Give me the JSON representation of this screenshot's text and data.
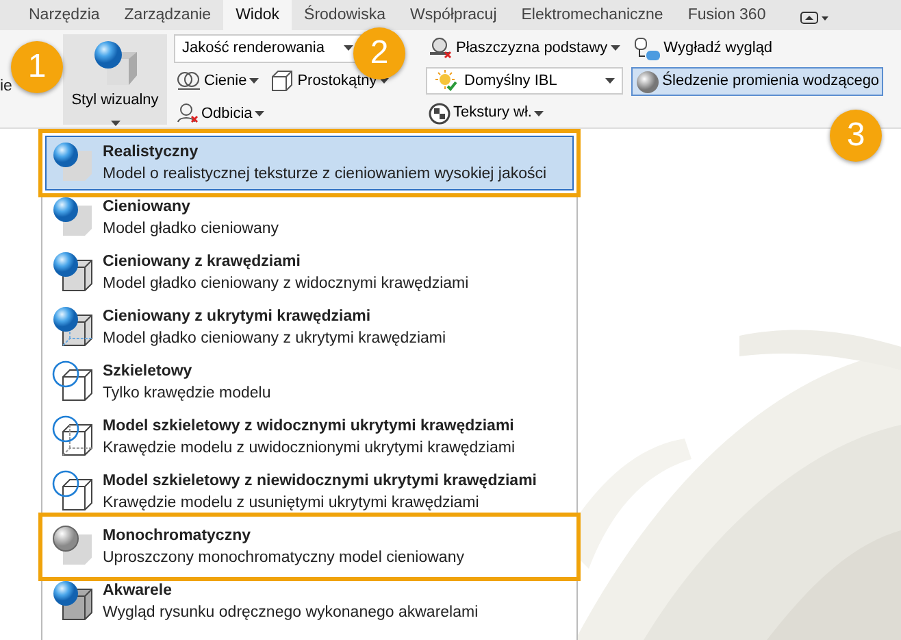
{
  "tabs": [
    {
      "label": "Narzędzia",
      "selected": false
    },
    {
      "label": "Zarządzanie",
      "selected": false
    },
    {
      "label": "Widok",
      "selected": true
    },
    {
      "label": "Środowiska",
      "selected": false
    },
    {
      "label": "Współpracuj",
      "selected": false
    },
    {
      "label": "Elektromechaniczne",
      "selected": false
    },
    {
      "label": "Fusion 360",
      "selected": false
    }
  ],
  "ribbon": {
    "cut_label": "ie",
    "visual_style": {
      "label": "Styl wizualny",
      "active": true
    },
    "columns": [
      [
        {
          "kind": "dropdown",
          "label": "Jakość renderowania"
        },
        {
          "kind": "pair",
          "items": [
            {
              "kind": "split",
              "label": "Cienie"
            },
            {
              "kind": "split",
              "label": "Prostokątny"
            }
          ]
        },
        {
          "kind": "split",
          "label": "Odbicia"
        }
      ],
      [
        {
          "kind": "split",
          "label": "Płaszczyzna podstawy"
        },
        {
          "kind": "dropdown",
          "label": "Domyślny IBL"
        },
        {
          "kind": "split",
          "label": "Tekstury wł."
        }
      ],
      [
        {
          "kind": "button",
          "label": "Wygładź wygląd"
        },
        {
          "kind": "toggle",
          "label": "Śledzenie promienia wodzącego",
          "on": true
        }
      ]
    ]
  },
  "callouts": [
    "1",
    "2",
    "3"
  ],
  "menu": [
    {
      "kind": "realistic",
      "title": "Realistyczny",
      "description": "Model o realistycznej teksturze z cieniowaniem wysokiej jakości",
      "selected": true,
      "highlighted": true
    },
    {
      "kind": "shaded",
      "title": "Cieniowany",
      "description": "Model gładko cieniowany",
      "selected": false,
      "highlighted": false
    },
    {
      "kind": "shaded-edges",
      "title": "Cieniowany z krawędziami",
      "description": "Model gładko cieniowany z widocznymi krawędziami",
      "selected": false,
      "highlighted": false
    },
    {
      "kind": "shaded-hidden",
      "title": "Cieniowany z ukrytymi krawędziami",
      "description": "Model gładko cieniowany z ukrytymi krawędziami",
      "selected": false,
      "highlighted": false
    },
    {
      "kind": "wireframe",
      "title": "Szkieletowy",
      "description": "Tylko krawędzie modelu",
      "selected": false,
      "highlighted": false
    },
    {
      "kind": "wireframe-hidden",
      "title": "Model szkieletowy z widocznymi ukrytymi krawędziami",
      "description": "Krawędzie modelu z uwidocznionymi ukrytymi krawędziami",
      "selected": false,
      "highlighted": false
    },
    {
      "kind": "wireframe",
      "title": "Model szkieletowy z niewidocznymi ukrytymi krawędziami",
      "description": "Krawędzie modelu z usuniętymi ukrytymi krawędziami",
      "selected": false,
      "highlighted": false
    },
    {
      "kind": "monochrome",
      "title": "Monochromatyczny",
      "description": "Uproszczony monochromatyczny model cieniowany",
      "selected": false,
      "highlighted": true
    },
    {
      "kind": "watercolor",
      "title": "Akwarele",
      "description": "Wygląd rysunku odręcznego wykonanego akwarelami",
      "selected": false,
      "highlighted": false
    }
  ]
}
